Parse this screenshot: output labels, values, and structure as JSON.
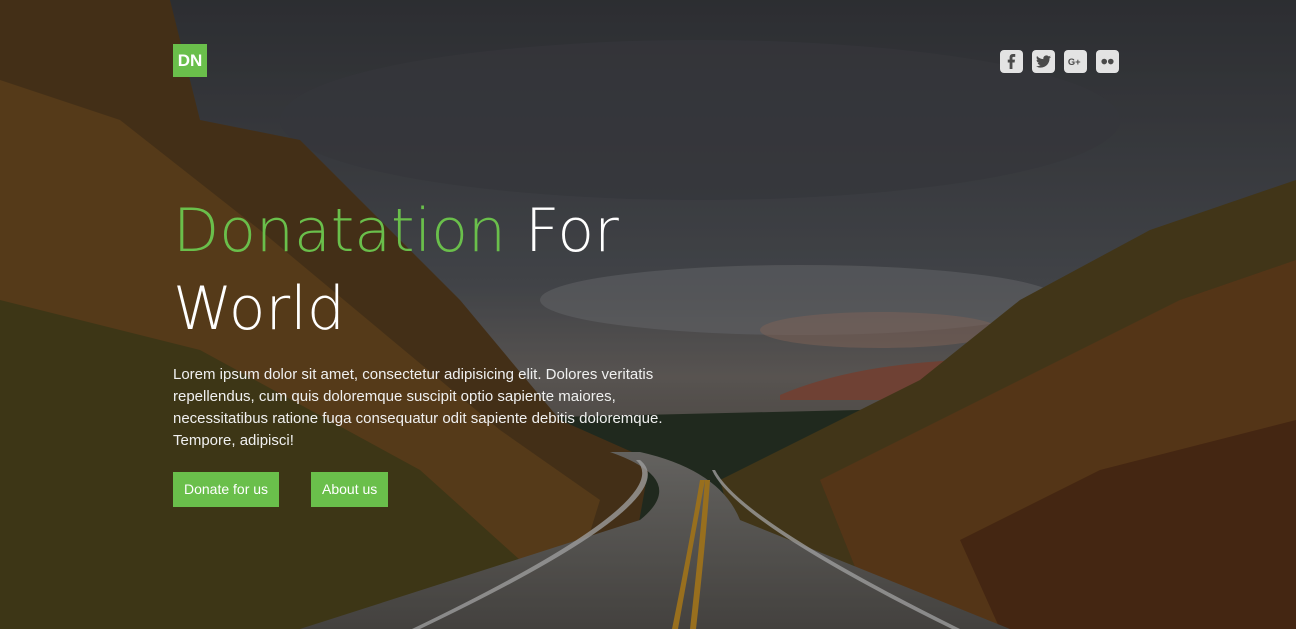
{
  "brand": {
    "logo_text": "DN",
    "accent_color": "#6abf4b"
  },
  "social": [
    {
      "icon": "facebook-icon",
      "glyph": "f"
    },
    {
      "icon": "twitter-icon",
      "glyph": "t"
    },
    {
      "icon": "google-plus-icon",
      "glyph": "G+"
    },
    {
      "icon": "flickr-icon",
      "glyph": "••"
    }
  ],
  "hero": {
    "title_accent": "Donatation",
    "title_rest": " For World",
    "description": "Lorem ipsum dolor sit amet, consectetur adipisicing elit. Dolores veritatis repellendus, cum quis doloremque suscipit optio sapiente maiores, necessitatibus ratione fuga consequatur odit sapiente debitis doloremque. Tempore, adipisci!",
    "donate_label": "Donate for us",
    "about_label": "About us"
  }
}
